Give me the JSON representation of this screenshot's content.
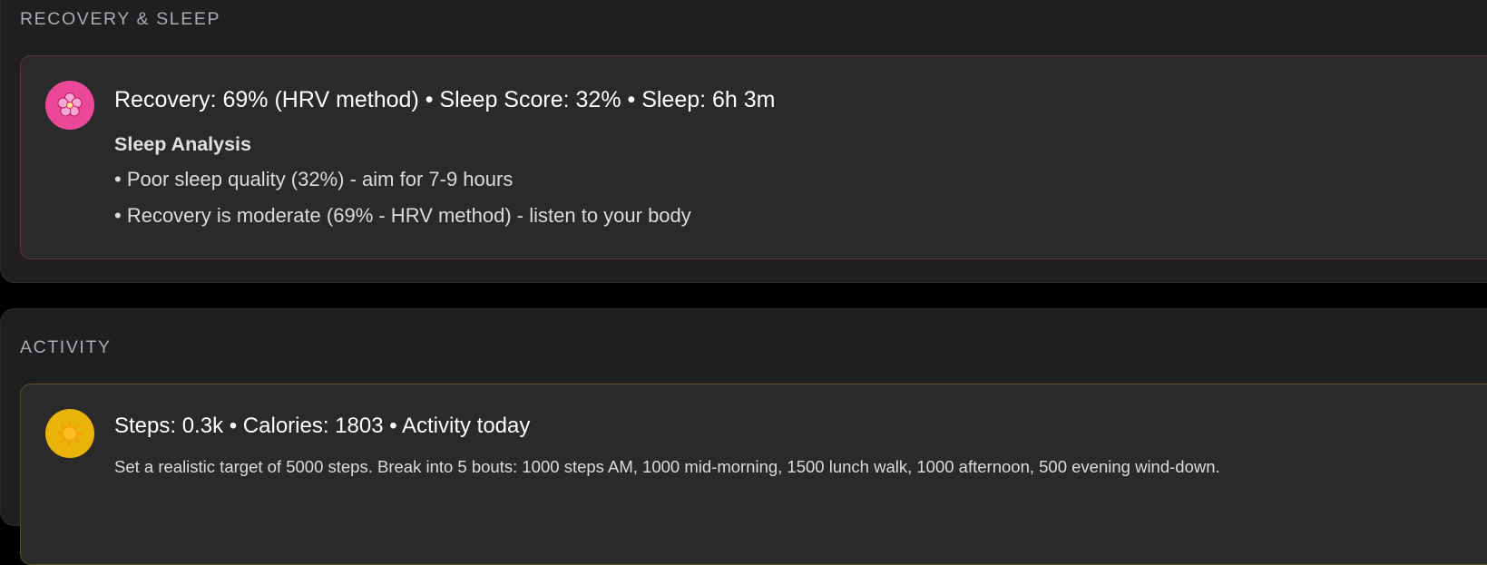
{
  "recovery_section": {
    "heading": "RECOVERY & SLEEP",
    "card": {
      "icon": "cherry-blossom-icon",
      "icon_glyph": "🌸",
      "icon_color": "#ec4899",
      "title": "Recovery: 69% (HRV method) • Sleep Score: 32% • Sleep: 6h 3m",
      "analysis_heading": "Sleep Analysis",
      "bullets": [
        "• Poor sleep quality (32%) - aim for 7-9 hours",
        "• Recovery is moderate (69% - HRV method) - listen to your body"
      ]
    }
  },
  "activity_section": {
    "heading": "ACTIVITY",
    "card": {
      "icon": "sun-icon",
      "icon_glyph": "🌞",
      "icon_color": "#eab308",
      "title": "Steps: 0.3k • Calories: 1803 • Activity today",
      "description": "Set a realistic target of 5000 steps. Break into 5 bouts: 1000 steps AM, 1000 mid-morning, 1500 lunch walk, 1000 afternoon, 500 evening wind-down."
    }
  }
}
